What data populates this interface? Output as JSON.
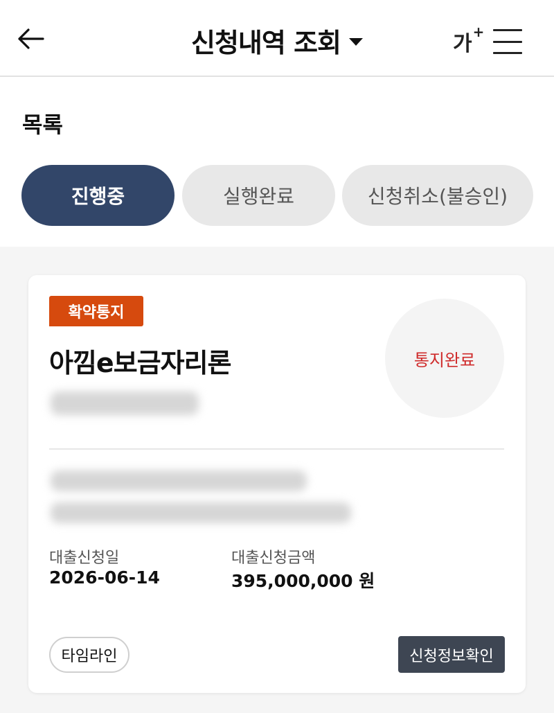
{
  "header": {
    "title": "신청내역 조회",
    "font_size_label": "가",
    "font_size_plus": "+"
  },
  "list": {
    "title": "목록",
    "tabs": [
      {
        "label": "진행중",
        "active": true
      },
      {
        "label": "실행완료",
        "active": false
      },
      {
        "label": "신청취소(불승인)",
        "active": false
      }
    ]
  },
  "card": {
    "tag": "확약통지",
    "product_name": "아낌e보금자리론",
    "status": "통지완료",
    "fields": [
      {
        "label": "대출신청일",
        "value": "2026-06-14"
      },
      {
        "label": "대출신청금액",
        "value": "395,000,000 원"
      }
    ],
    "timeline_label": "타임라인",
    "apply_info_label": "신청정보확인"
  },
  "colors": {
    "active_tab": "#324669",
    "tag": "#d64a0e",
    "status_text": "#cf2b2b",
    "apply_button": "#3e4653"
  }
}
